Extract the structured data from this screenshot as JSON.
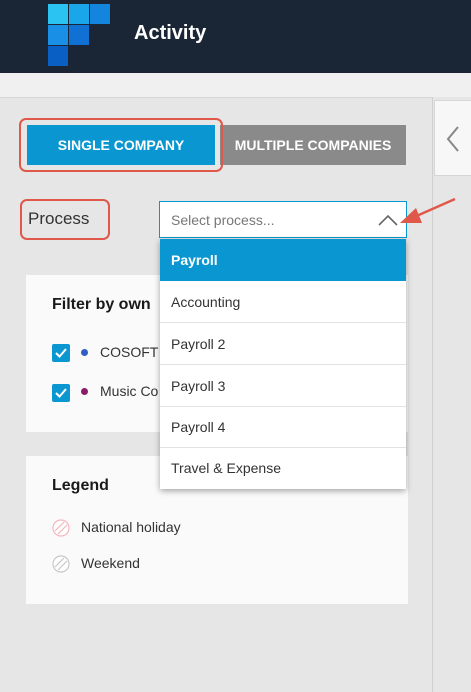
{
  "header": {
    "title": "Activity",
    "logo_icon": "logo-icon",
    "colors": {
      "background": "#1a2535",
      "logo_dark": "#0a5fc4",
      "logo_light": "#2ac3f2"
    }
  },
  "toggle": {
    "single_label": "SINGLE COMPANY",
    "multiple_label": "MULTIPLE COMPANIES",
    "selected": "SINGLE COMPANY",
    "colors": {
      "active": "#0a97d1",
      "inactive": "#8a8a8a"
    }
  },
  "process": {
    "label": "Process",
    "placeholder": "Select process...",
    "options": [
      {
        "label": "Payroll",
        "highlighted": true
      },
      {
        "label": "Accounting"
      },
      {
        "label": "Payroll 2"
      },
      {
        "label": "Payroll 3"
      },
      {
        "label": "Payroll 4"
      },
      {
        "label": "Travel & Expense"
      }
    ]
  },
  "filter": {
    "title": "Filter by own",
    "companies": [
      {
        "label": "COSOFT",
        "checked": true,
        "dot_color": "#2f5fc4"
      },
      {
        "label": "Music Co",
        "checked": true,
        "dot_color": "#8c1a6a"
      }
    ]
  },
  "legend": {
    "title": "Legend",
    "items": [
      {
        "label": "National holiday",
        "icon": "national-holiday-icon",
        "color": "#f3b6bd"
      },
      {
        "label": "Weekend",
        "icon": "weekend-icon",
        "color": "#c8c8c8"
      }
    ]
  },
  "annotation_color": "#e0584a",
  "side_panel": {
    "collapse_icon": "chevron-left-icon"
  }
}
